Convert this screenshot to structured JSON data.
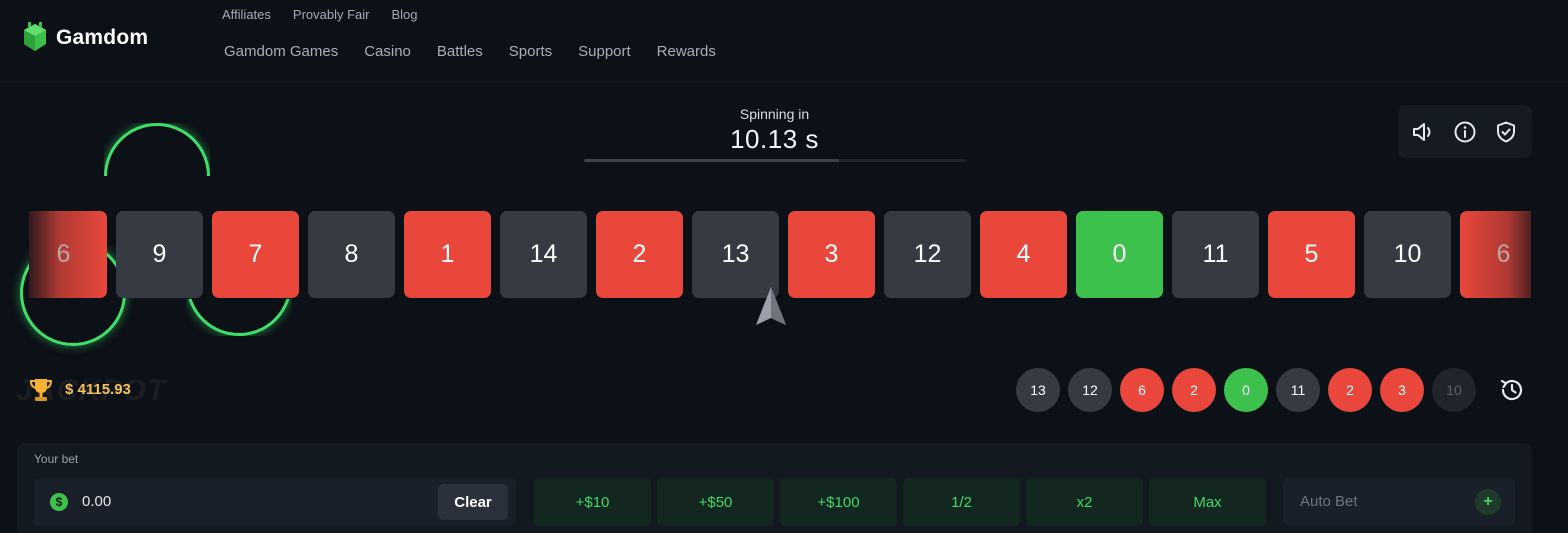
{
  "brand": {
    "name": "Gamdom",
    "accent": "#3cc24c"
  },
  "top_nav": [
    "Affiliates",
    "Provably Fair",
    "Blog"
  ],
  "main_nav": [
    "Gamdom Games",
    "Casino",
    "Battles",
    "Sports",
    "Support",
    "Rewards"
  ],
  "timer": {
    "label": "Spinning in",
    "value": "10.13 s",
    "progress": 0.67
  },
  "controls": [
    "sound-icon",
    "info-icon",
    "shield-check-icon"
  ],
  "strip": [
    {
      "number": "6",
      "color": "red"
    },
    {
      "number": "9",
      "color": "dark"
    },
    {
      "number": "7",
      "color": "red"
    },
    {
      "number": "8",
      "color": "dark"
    },
    {
      "number": "1",
      "color": "red"
    },
    {
      "number": "14",
      "color": "dark"
    },
    {
      "number": "2",
      "color": "red"
    },
    {
      "number": "13",
      "color": "dark"
    },
    {
      "number": "3",
      "color": "red"
    },
    {
      "number": "12",
      "color": "dark"
    },
    {
      "number": "4",
      "color": "red"
    },
    {
      "number": "0",
      "color": "green"
    },
    {
      "number": "11",
      "color": "dark"
    },
    {
      "number": "5",
      "color": "red"
    },
    {
      "number": "10",
      "color": "dark"
    },
    {
      "number": "6",
      "color": "red"
    }
  ],
  "jackpot": {
    "watermark": "JACKPOT",
    "amount": "$ 4115.93"
  },
  "history": [
    {
      "number": "13",
      "color": "dark"
    },
    {
      "number": "12",
      "color": "dark"
    },
    {
      "number": "6",
      "color": "red"
    },
    {
      "number": "2",
      "color": "red"
    },
    {
      "number": "0",
      "color": "green"
    },
    {
      "number": "11",
      "color": "dark"
    },
    {
      "number": "2",
      "color": "red"
    },
    {
      "number": "3",
      "color": "red"
    },
    {
      "number": "10",
      "color": "faded"
    }
  ],
  "bet": {
    "label": "Your bet",
    "currency_symbol": "$",
    "value": "0.00",
    "clear_label": "Clear",
    "chips": [
      "+$10",
      "+$50",
      "+$100",
      "1/2",
      "x2",
      "Max"
    ],
    "autobet_label": "Auto Bet",
    "autobet_plus": "+"
  }
}
